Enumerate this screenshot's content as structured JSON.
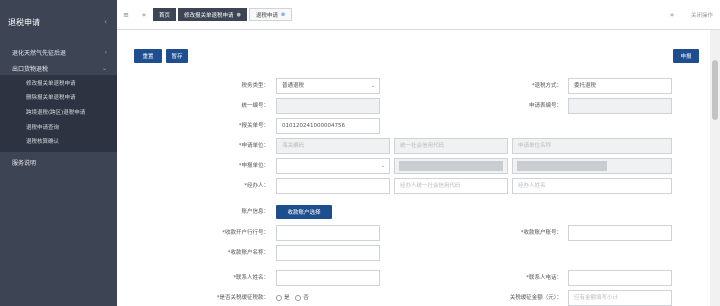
{
  "sidebar": {
    "title": "退税申请",
    "items": [
      {
        "label": "退化天然气先征后退"
      },
      {
        "label": "出口货物退税"
      }
    ],
    "sub_items": [
      "修改报关单退税申请",
      "删除报关单退税申请",
      "跨境退税(跨区)退税申请",
      "退税申请查询",
      "退税核算确认"
    ],
    "bottom_item": "服务说明"
  },
  "tabbar": {
    "tabs": [
      "首页",
      "修改报关单退税申请",
      "退税申请"
    ],
    "close_all": "关闭操作"
  },
  "toolbar": {
    "reset": "重置",
    "save": "暂存",
    "submit": "申报"
  },
  "form": {
    "tax_type": {
      "label": "税务类型：",
      "value": "普通退税"
    },
    "agent_method": {
      "label": "*退税方式：",
      "value": "委托退税"
    },
    "uniform_no": {
      "label": "统一编号："
    },
    "apply_no": {
      "label": "申请表编号："
    },
    "customs_no": {
      "label": "*报关单号：",
      "value": "010120241000004756"
    },
    "apply_unit": {
      "label": "*申请单位：",
      "placeholder1": "海关编码",
      "placeholder2": "统一社会信用代码",
      "placeholder3": "申请单位名称"
    },
    "declare_unit": {
      "label": "*申报单位："
    },
    "operator": {
      "label": "*经办人：",
      "placeholder1": "经办人统一社会信用代码",
      "placeholder2": "经办人姓名"
    },
    "account_info": {
      "label": "账户信息：",
      "button": "收款账户选择"
    },
    "bank": {
      "label": "*收款开户行行号："
    },
    "account_no": {
      "label": "*收款账户账号："
    },
    "account_name": {
      "label": "*收款账户名称："
    },
    "contact_name": {
      "label": "*联系人姓名："
    },
    "contact_phone": {
      "label": "*联系人电话："
    },
    "is_deleted": {
      "label": "*是否关税缓征税款：",
      "yes": "是",
      "no": "否"
    },
    "amount": {
      "label": "关税缓征金额（元）：",
      "placeholder": "应有金额填写小计"
    }
  }
}
